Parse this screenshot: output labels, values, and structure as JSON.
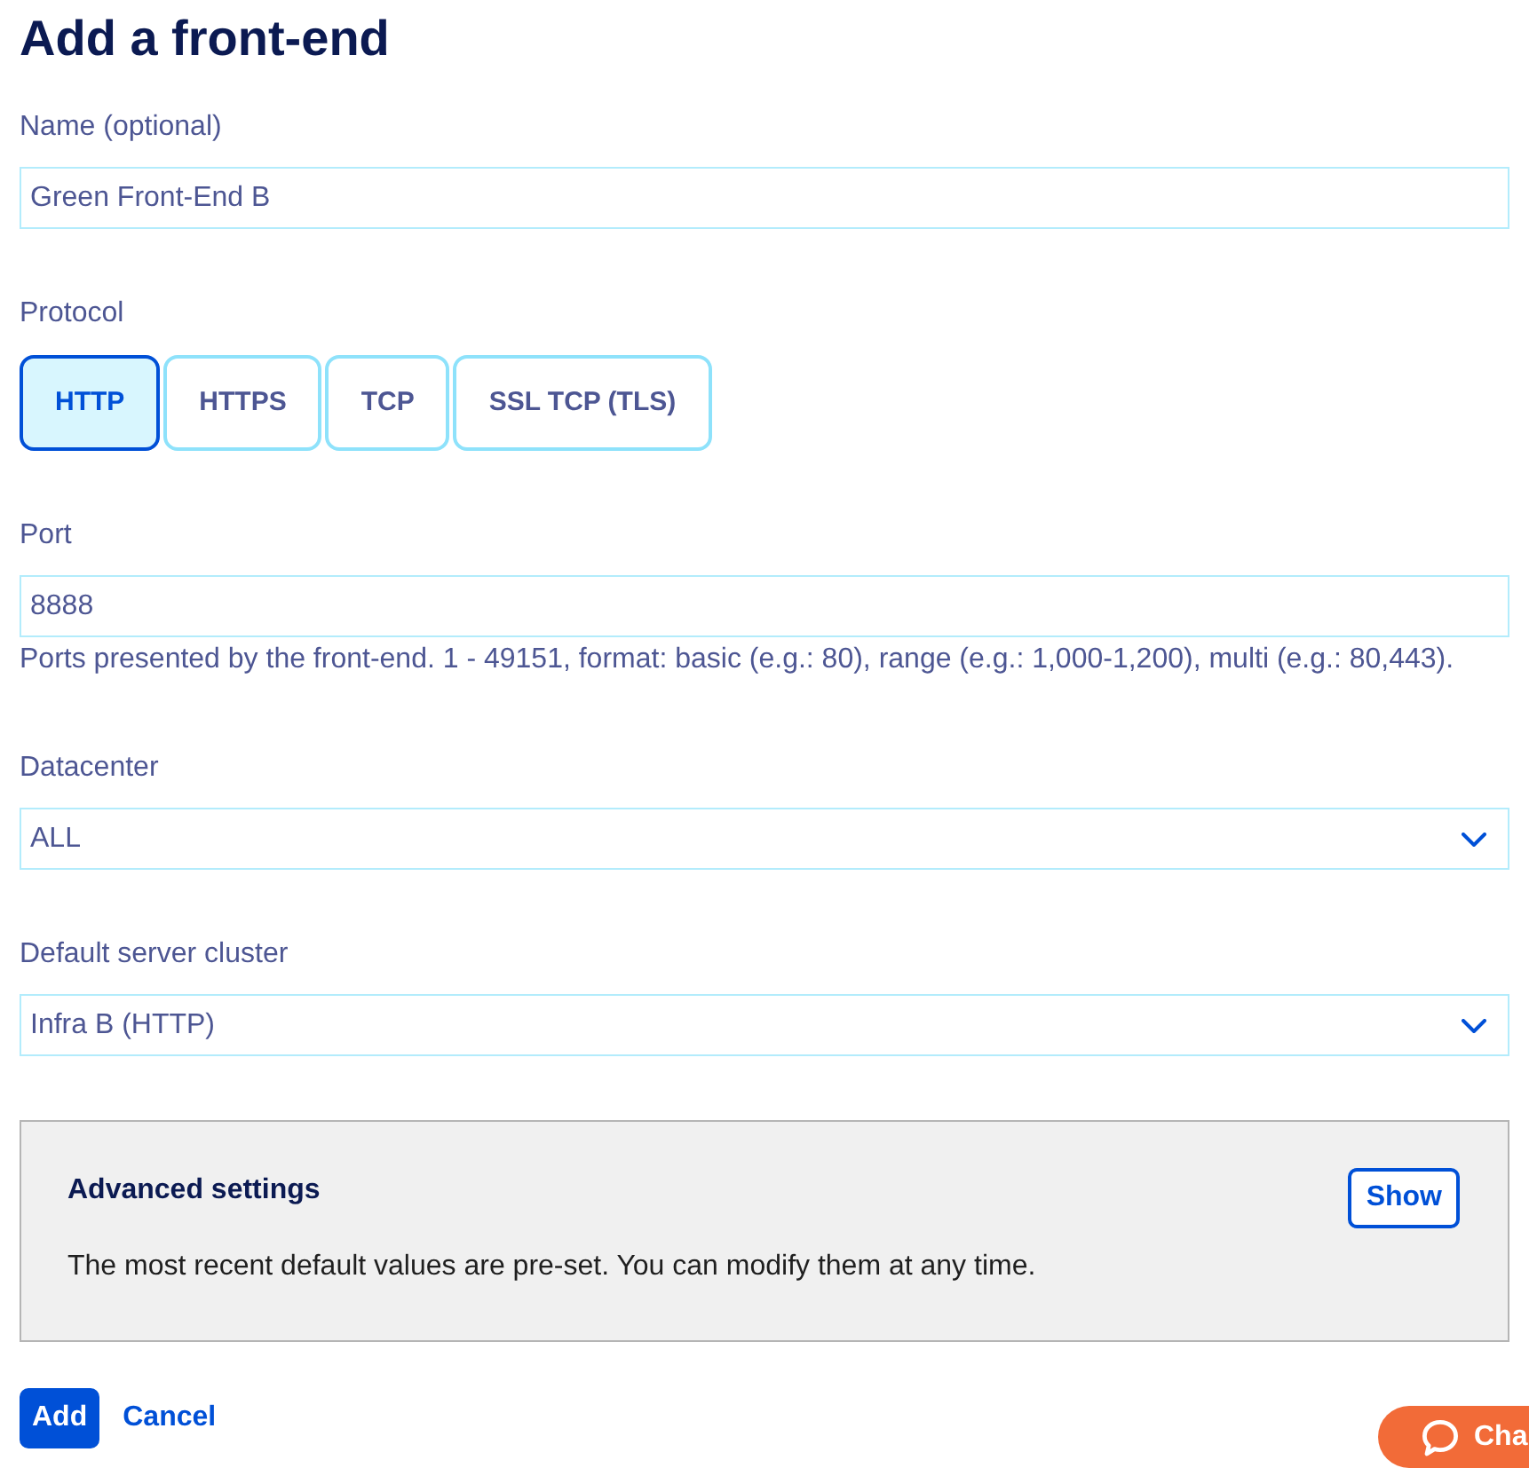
{
  "page": {
    "title": "Add a front-end"
  },
  "fields": [
    {
      "kind": "text",
      "label": "Name (optional)",
      "value": "Green Front-End B"
    },
    {
      "kind": "choice",
      "label": "Protocol",
      "options": [
        {
          "label": "HTTP",
          "selected": true
        },
        {
          "label": "HTTPS",
          "selected": false
        },
        {
          "label": "TCP",
          "selected": false
        },
        {
          "label": "SSL TCP (TLS)",
          "selected": false
        }
      ]
    },
    {
      "kind": "text",
      "label": "Port",
      "value": "8888",
      "help": "Ports presented by the front-end. 1 - 49151, format: basic (e.g.: 80), range (e.g.: 1,000-1,200), multi (e.g.: 80,443)."
    },
    {
      "kind": "select",
      "label": "Datacenter",
      "value": "ALL"
    },
    {
      "kind": "select",
      "label": "Default server cluster",
      "value": "Infra B (HTTP)"
    }
  ],
  "advanced_settings": {
    "title": "Advanced settings",
    "description": "The most recent default values are pre-set. You can modify them at any time.",
    "button": "Show"
  },
  "actions": [
    {
      "kind": "primary",
      "label": "Add"
    },
    {
      "kind": "link",
      "label": "Cancel"
    }
  ],
  "chat_button": {
    "label": "Cha"
  }
}
